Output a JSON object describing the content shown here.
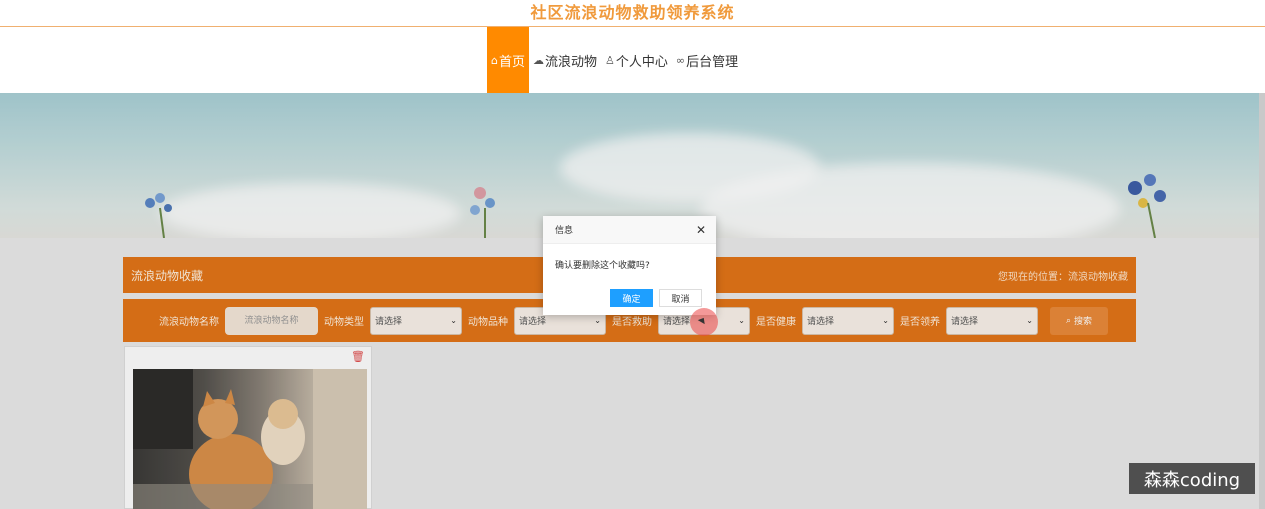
{
  "site": {
    "title": "社区流浪动物救助领养系统"
  },
  "nav": {
    "items": [
      {
        "icon": "home-icon",
        "label": "首页",
        "active": true
      },
      {
        "icon": "cloud-icon",
        "label": "流浪动物",
        "active": false
      },
      {
        "icon": "user-icon",
        "label": "个人中心",
        "active": false
      },
      {
        "icon": "link-icon",
        "label": "后台管理",
        "active": false
      }
    ]
  },
  "breadcrumb": {
    "title": "流浪动物收藏",
    "location": "您现在的位置：流浪动物收藏"
  },
  "filters": {
    "name_label": "流浪动物名称",
    "name_placeholder": "流浪动物名称",
    "type_label": "动物类型",
    "type_value": "请选择",
    "breed_label": "动物品种",
    "breed_value": "请选择",
    "rescued_label": "是否救助",
    "rescued_value": "请选择",
    "healthy_label": "是否健康",
    "healthy_value": "请选择",
    "adopted_label": "是否领养",
    "adopted_value": "请选择",
    "search_label": "搜索"
  },
  "dialog": {
    "title": "信息",
    "message": "确认要删除这个收藏吗?",
    "ok_label": "确定",
    "cancel_label": "取消"
  },
  "watermark": "森森coding",
  "colors": {
    "accent": "#e27418",
    "nav_active": "#ff8a00",
    "title": "#f09a3c",
    "dialog_ok": "#1e9fff"
  }
}
